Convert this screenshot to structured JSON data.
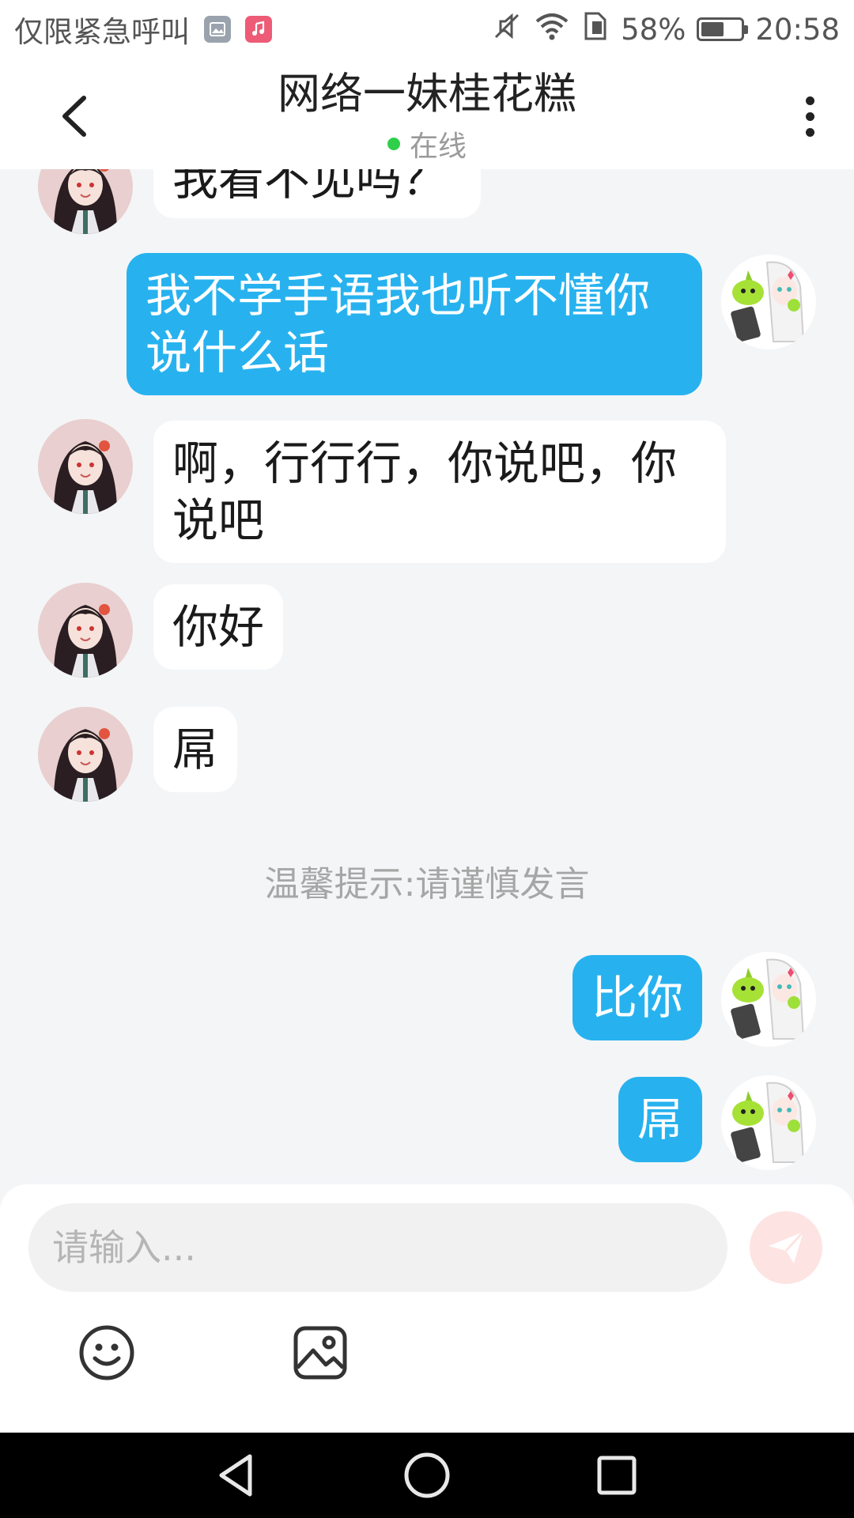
{
  "status_bar": {
    "carrier": "仅限紧急呼叫",
    "battery": "58%",
    "time": "20:58",
    "battery_level": 0.58,
    "icons": [
      "gallery-icon",
      "music-icon",
      "mute-icon",
      "wifi-icon",
      "sim-icon",
      "battery-icon"
    ]
  },
  "header": {
    "title": "网络一妹桂花糕",
    "status": "在线",
    "online_color": "#2fcf4a"
  },
  "messages": [
    {
      "side": "in",
      "text": "我看不见吗？",
      "partial": true
    },
    {
      "side": "out",
      "text": "我不学手语我也听不懂你说什么话"
    },
    {
      "side": "in",
      "text": "啊，行行行，你说吧，你说吧"
    },
    {
      "side": "in",
      "text": "你好"
    },
    {
      "side": "in",
      "text": "屌"
    },
    {
      "side": "out",
      "text": "比你"
    },
    {
      "side": "out",
      "text": "屌"
    }
  ],
  "tip": "温馨提示:请谨慎发言",
  "composer": {
    "placeholder": "请输入...",
    "send_icon": "send-icon",
    "tools": [
      "emoji-icon",
      "image-icon"
    ]
  },
  "navbar": {
    "icons": [
      "back-triangle-icon",
      "home-circle-icon",
      "recents-square-icon"
    ]
  },
  "colors": {
    "accent": "#27b2ef",
    "background": "#f4f5f7",
    "send_bg": "#fde3e1"
  }
}
